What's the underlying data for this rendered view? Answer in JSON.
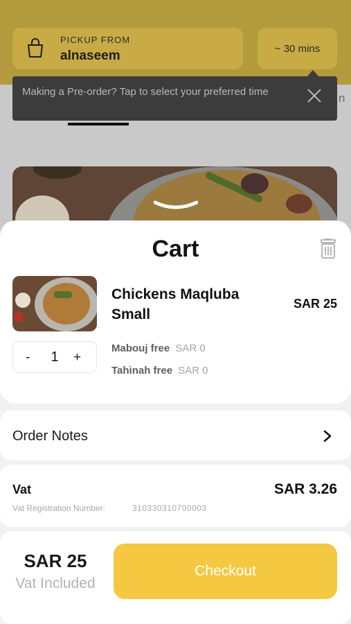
{
  "pickup": {
    "label": "PICKUP FROM",
    "location": "alnaseem",
    "eta": "~ 30 mins"
  },
  "tooltip": {
    "text": "Making a Pre-order? Tap to select your preferred time",
    "edge_letter": "n"
  },
  "cart": {
    "title": "Cart",
    "items": [
      {
        "name": "Chickens Maqluba Small",
        "price": "SAR 25",
        "quantity": "1",
        "minus": "-",
        "plus": "+",
        "addons": [
          {
            "name": "Mabouj free",
            "price": "SAR 0"
          },
          {
            "name": "Tahinah free",
            "price": "SAR 0"
          }
        ]
      }
    ]
  },
  "order_notes": {
    "label": "Order Notes"
  },
  "vat": {
    "label": "Vat",
    "value": "SAR 3.26",
    "registration_label": "Vat Registration Number:",
    "registration_number": "310330310700003"
  },
  "footer": {
    "total": "SAR 25",
    "total_note": "Vat Included",
    "checkout_label": "Checkout"
  },
  "colors": {
    "accent": "#f5c842",
    "header_dim": "#b39a3d",
    "tooltip_bg": "#3c3c3c",
    "sheet_bg": "#f1f1f1"
  },
  "icons": {
    "pickup": "shopping-bag-icon",
    "tooltip_close": "close-icon",
    "sheet_handle": "chevron-down-icon",
    "trash": "trash-icon",
    "notes": "chevron-right-icon"
  }
}
